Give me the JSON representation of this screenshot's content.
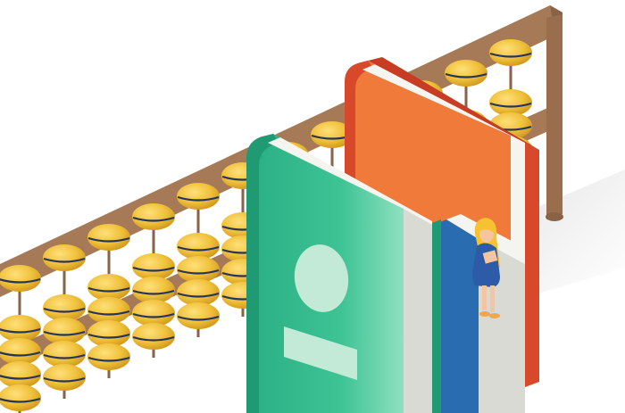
{
  "scene": {
    "title": "",
    "colors": {
      "background": "#ffffff",
      "frame_wood": "#a77a57",
      "frame_wood_dark": "#8a6246",
      "bead_gold": "#f0c23c",
      "bead_shadow": "#d8a21b",
      "bead_band": "#25345c",
      "green_book": "#2aae84",
      "green_book_light": "#5fd0a8",
      "orange_book": "#ef7a39",
      "orange_book_spine": "#d8482b",
      "blue_book": "#2a6cb0",
      "page_white": "#f4f4f0",
      "page_gray": "#dadad4",
      "girl_dress": "#2d5ba8",
      "girl_hair": "#f6c232",
      "girl_skin": "#f5c5a0"
    },
    "icons": {
      "abacus": "abacus-icon",
      "green_book": "green-book-icon",
      "orange_book": "orange-book-icon",
      "blue_book": "blue-book-icon",
      "girl": "reading-girl-icon"
    }
  }
}
